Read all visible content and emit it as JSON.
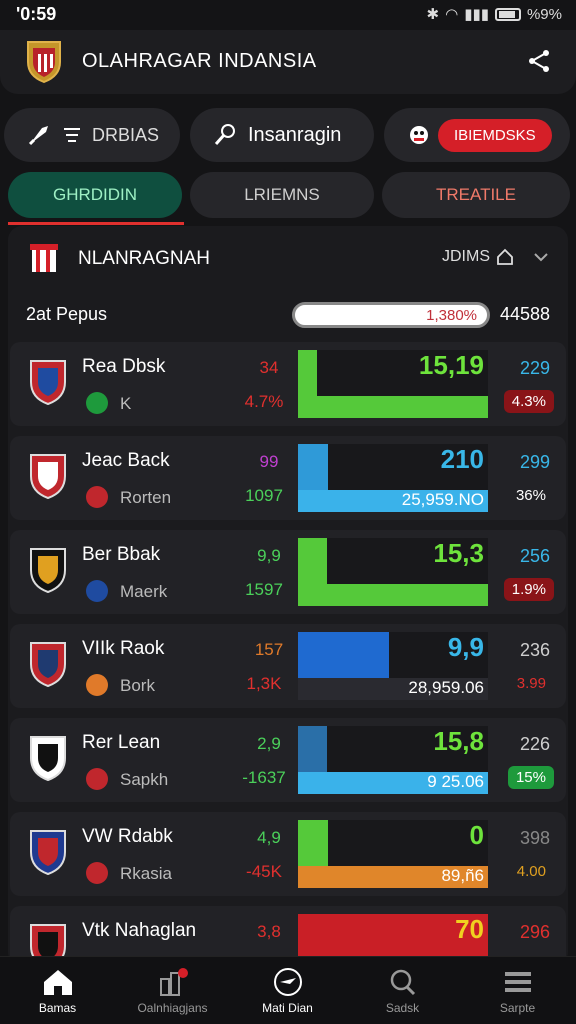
{
  "status": {
    "time": "'0:59",
    "right": "%9%"
  },
  "header": {
    "title": "OLAHRAGAR INDANSIA"
  },
  "chips": [
    {
      "label": "DRBIAS",
      "icon": "rocket-icon"
    },
    {
      "label": "Insanragin",
      "icon": "microphone-icon"
    },
    {
      "label": "IBIEMDSKS",
      "icon": "mascot-icon"
    }
  ],
  "tabs": [
    "GHRDIDIN",
    "LRIEMNS",
    "TREATILE"
  ],
  "panel": {
    "title": "NLANRAGNAH",
    "link": "JDIMS",
    "summary_label": "2at Pepus",
    "summary_pct": "1,380%",
    "summary_value": "44588"
  },
  "rows": [
    {
      "team": "Rea Dbsk",
      "sub": "K",
      "n1": "34",
      "n2": "4.7%",
      "big": "15,19",
      "small": "",
      "r1": "229",
      "r2": "4.3%",
      "chart_fill": 1.0,
      "n1c": "#e0302e",
      "n2c": "#e0302e",
      "bigc": "#6ee33c",
      "b1c": "#55c93a",
      "b2c": "#55c93a",
      "b1w": 0.1,
      "b2w": 1.0,
      "r1c": "#39b7e8",
      "r2bg": "#8a1418"
    },
    {
      "team": "Jeac Back",
      "sub": "Rorten",
      "n1": "99",
      "n2": "1097",
      "big": "210",
      "small": "25,959.NO",
      "r1": "299",
      "r2": "36%",
      "n1c": "#c040d0",
      "n2c": "#4bd05a",
      "bigc": "#39b7e8",
      "b1c": "#2f9ad8",
      "b2c": "#3ab2ea",
      "b1w": 0.16,
      "b2w": 1.0,
      "r1c": "#39b7e8",
      "r2bg": "transparent"
    },
    {
      "team": "Ber Bbak",
      "sub": "Maerk",
      "n1": "9,9",
      "n2": "1597",
      "big": "15,3",
      "small": "",
      "r1": "256",
      "r2": "1.9%",
      "n1c": "#4bd05a",
      "n2c": "#4bd05a",
      "bigc": "#6ee33c",
      "b1c": "#55c93a",
      "b2c": "#55c93a",
      "b1w": 0.15,
      "b2w": 1.0,
      "r1c": "#39b7e8",
      "r2bg": "#8a1418"
    },
    {
      "team": "VIIk Raok",
      "sub": "Bork",
      "n1": "157",
      "n2": "1,3K",
      "big": "9,9",
      "small": "28,959.06",
      "r1": "236",
      "r2": "3.99",
      "n1c": "#e07a2a",
      "n2c": "#e0302e",
      "bigc": "#39b7e8",
      "b1c": "#1f6ad0",
      "b2c": "#2a2a30",
      "b1w": 0.48,
      "b2w": 1.0,
      "r1c": "#cfcfcf",
      "r2bg": "transparent",
      "r2c": "#e0302e"
    },
    {
      "team": "Rer Lean",
      "sub": "Sapkh",
      "n1": "2,9",
      "n2": "-1637",
      "big": "15,8",
      "small": "9 25.06",
      "r1": "226",
      "r2": "15%",
      "n1c": "#4bd05a",
      "n2c": "#4bd05a",
      "bigc": "#6ee33c",
      "b1c": "#2a6fa8",
      "b2c": "#3ab2ea",
      "b1w": 0.15,
      "b2w": 1.0,
      "r1c": "#cfcfcf",
      "r2bg": "#1e9a3c"
    },
    {
      "team": "VW Rdabk",
      "sub": "Rkasia",
      "n1": "4,9",
      "n2": "-45K",
      "big": "0",
      "small": "89,ñ6",
      "r1": "398",
      "r2": "4.00",
      "n1c": "#4bd05a",
      "n2c": "#e0302e",
      "bigc": "#6ee33c",
      "b1c": "#55c93a",
      "b2c": "#e0862a",
      "b1w": 0.16,
      "b2w": 1.0,
      "r1c": "#888",
      "r2bg": "transparent",
      "r2c": "#e0a020"
    },
    {
      "team": "Vtk Nahaglan",
      "sub": "",
      "n1": "3,8",
      "n2": "",
      "big": "70",
      "small": "",
      "r1": "296",
      "r2": "",
      "n1c": "#e0302e",
      "n2c": "#e0302e",
      "bigc": "#f0d020",
      "b1c": "#c91f26",
      "b2c": "#1e9a3c",
      "b1w": 1.0,
      "b2w": 1.0,
      "r1c": "#e0302e",
      "r2bg": "transparent"
    }
  ],
  "bottom_nav": [
    {
      "label": "Bamas",
      "icon": "home-icon"
    },
    {
      "label": "Oalnhiagjans",
      "icon": "stats-icon"
    },
    {
      "label": "Mati Dian",
      "icon": "plane-icon"
    },
    {
      "label": "Sadsk",
      "icon": "search-icon"
    },
    {
      "label": "Sarpte",
      "icon": "menu-icon"
    }
  ]
}
